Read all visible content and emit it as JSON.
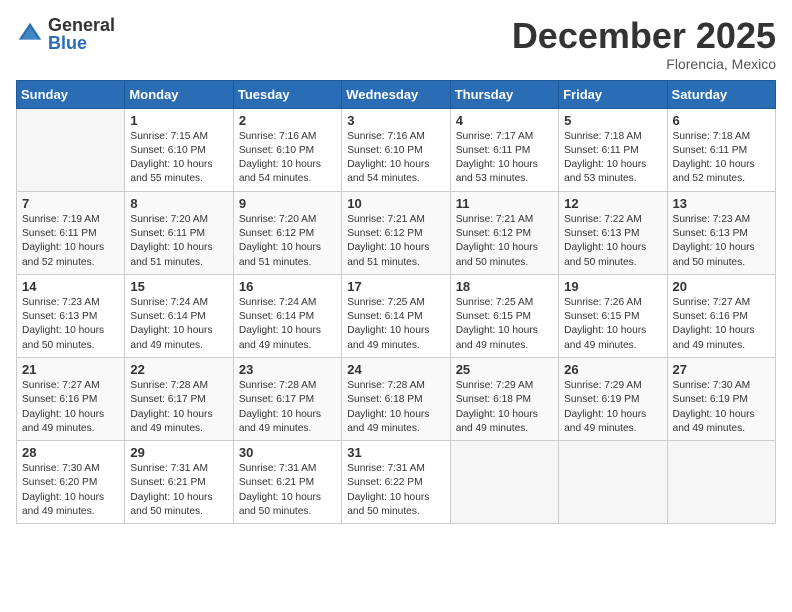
{
  "logo": {
    "general": "General",
    "blue": "Blue"
  },
  "title": "December 2025",
  "location": "Florencia, Mexico",
  "weekdays": [
    "Sunday",
    "Monday",
    "Tuesday",
    "Wednesday",
    "Thursday",
    "Friday",
    "Saturday"
  ],
  "weeks": [
    [
      {
        "day": "",
        "sunrise": "",
        "sunset": "",
        "daylight": ""
      },
      {
        "day": "1",
        "sunrise": "Sunrise: 7:15 AM",
        "sunset": "Sunset: 6:10 PM",
        "daylight": "Daylight: 10 hours and 55 minutes."
      },
      {
        "day": "2",
        "sunrise": "Sunrise: 7:16 AM",
        "sunset": "Sunset: 6:10 PM",
        "daylight": "Daylight: 10 hours and 54 minutes."
      },
      {
        "day": "3",
        "sunrise": "Sunrise: 7:16 AM",
        "sunset": "Sunset: 6:10 PM",
        "daylight": "Daylight: 10 hours and 54 minutes."
      },
      {
        "day": "4",
        "sunrise": "Sunrise: 7:17 AM",
        "sunset": "Sunset: 6:11 PM",
        "daylight": "Daylight: 10 hours and 53 minutes."
      },
      {
        "day": "5",
        "sunrise": "Sunrise: 7:18 AM",
        "sunset": "Sunset: 6:11 PM",
        "daylight": "Daylight: 10 hours and 53 minutes."
      },
      {
        "day": "6",
        "sunrise": "Sunrise: 7:18 AM",
        "sunset": "Sunset: 6:11 PM",
        "daylight": "Daylight: 10 hours and 52 minutes."
      }
    ],
    [
      {
        "day": "7",
        "sunrise": "Sunrise: 7:19 AM",
        "sunset": "Sunset: 6:11 PM",
        "daylight": "Daylight: 10 hours and 52 minutes."
      },
      {
        "day": "8",
        "sunrise": "Sunrise: 7:20 AM",
        "sunset": "Sunset: 6:11 PM",
        "daylight": "Daylight: 10 hours and 51 minutes."
      },
      {
        "day": "9",
        "sunrise": "Sunrise: 7:20 AM",
        "sunset": "Sunset: 6:12 PM",
        "daylight": "Daylight: 10 hours and 51 minutes."
      },
      {
        "day": "10",
        "sunrise": "Sunrise: 7:21 AM",
        "sunset": "Sunset: 6:12 PM",
        "daylight": "Daylight: 10 hours and 51 minutes."
      },
      {
        "day": "11",
        "sunrise": "Sunrise: 7:21 AM",
        "sunset": "Sunset: 6:12 PM",
        "daylight": "Daylight: 10 hours and 50 minutes."
      },
      {
        "day": "12",
        "sunrise": "Sunrise: 7:22 AM",
        "sunset": "Sunset: 6:13 PM",
        "daylight": "Daylight: 10 hours and 50 minutes."
      },
      {
        "day": "13",
        "sunrise": "Sunrise: 7:23 AM",
        "sunset": "Sunset: 6:13 PM",
        "daylight": "Daylight: 10 hours and 50 minutes."
      }
    ],
    [
      {
        "day": "14",
        "sunrise": "Sunrise: 7:23 AM",
        "sunset": "Sunset: 6:13 PM",
        "daylight": "Daylight: 10 hours and 50 minutes."
      },
      {
        "day": "15",
        "sunrise": "Sunrise: 7:24 AM",
        "sunset": "Sunset: 6:14 PM",
        "daylight": "Daylight: 10 hours and 49 minutes."
      },
      {
        "day": "16",
        "sunrise": "Sunrise: 7:24 AM",
        "sunset": "Sunset: 6:14 PM",
        "daylight": "Daylight: 10 hours and 49 minutes."
      },
      {
        "day": "17",
        "sunrise": "Sunrise: 7:25 AM",
        "sunset": "Sunset: 6:14 PM",
        "daylight": "Daylight: 10 hours and 49 minutes."
      },
      {
        "day": "18",
        "sunrise": "Sunrise: 7:25 AM",
        "sunset": "Sunset: 6:15 PM",
        "daylight": "Daylight: 10 hours and 49 minutes."
      },
      {
        "day": "19",
        "sunrise": "Sunrise: 7:26 AM",
        "sunset": "Sunset: 6:15 PM",
        "daylight": "Daylight: 10 hours and 49 minutes."
      },
      {
        "day": "20",
        "sunrise": "Sunrise: 7:27 AM",
        "sunset": "Sunset: 6:16 PM",
        "daylight": "Daylight: 10 hours and 49 minutes."
      }
    ],
    [
      {
        "day": "21",
        "sunrise": "Sunrise: 7:27 AM",
        "sunset": "Sunset: 6:16 PM",
        "daylight": "Daylight: 10 hours and 49 minutes."
      },
      {
        "day": "22",
        "sunrise": "Sunrise: 7:28 AM",
        "sunset": "Sunset: 6:17 PM",
        "daylight": "Daylight: 10 hours and 49 minutes."
      },
      {
        "day": "23",
        "sunrise": "Sunrise: 7:28 AM",
        "sunset": "Sunset: 6:17 PM",
        "daylight": "Daylight: 10 hours and 49 minutes."
      },
      {
        "day": "24",
        "sunrise": "Sunrise: 7:28 AM",
        "sunset": "Sunset: 6:18 PM",
        "daylight": "Daylight: 10 hours and 49 minutes."
      },
      {
        "day": "25",
        "sunrise": "Sunrise: 7:29 AM",
        "sunset": "Sunset: 6:18 PM",
        "daylight": "Daylight: 10 hours and 49 minutes."
      },
      {
        "day": "26",
        "sunrise": "Sunrise: 7:29 AM",
        "sunset": "Sunset: 6:19 PM",
        "daylight": "Daylight: 10 hours and 49 minutes."
      },
      {
        "day": "27",
        "sunrise": "Sunrise: 7:30 AM",
        "sunset": "Sunset: 6:19 PM",
        "daylight": "Daylight: 10 hours and 49 minutes."
      }
    ],
    [
      {
        "day": "28",
        "sunrise": "Sunrise: 7:30 AM",
        "sunset": "Sunset: 6:20 PM",
        "daylight": "Daylight: 10 hours and 49 minutes."
      },
      {
        "day": "29",
        "sunrise": "Sunrise: 7:31 AM",
        "sunset": "Sunset: 6:21 PM",
        "daylight": "Daylight: 10 hours and 50 minutes."
      },
      {
        "day": "30",
        "sunrise": "Sunrise: 7:31 AM",
        "sunset": "Sunset: 6:21 PM",
        "daylight": "Daylight: 10 hours and 50 minutes."
      },
      {
        "day": "31",
        "sunrise": "Sunrise: 7:31 AM",
        "sunset": "Sunset: 6:22 PM",
        "daylight": "Daylight: 10 hours and 50 minutes."
      },
      {
        "day": "",
        "sunrise": "",
        "sunset": "",
        "daylight": ""
      },
      {
        "day": "",
        "sunrise": "",
        "sunset": "",
        "daylight": ""
      },
      {
        "day": "",
        "sunrise": "",
        "sunset": "",
        "daylight": ""
      }
    ]
  ]
}
